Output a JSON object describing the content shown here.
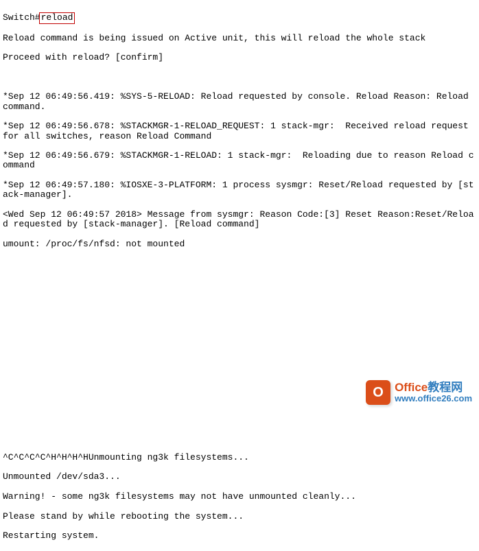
{
  "terminal": {
    "prompt": "Switch#",
    "command": "reload",
    "lines": [
      "Reload command is being issued on Active unit, this will reload the whole stack",
      "Proceed with reload? [confirm]",
      "",
      "*Sep 12 06:49:56.419: %SYS-5-RELOAD: Reload requested by console. Reload Reason: Reload command.",
      "*Sep 12 06:49:56.678: %STACKMGR-1-RELOAD_REQUEST: 1 stack-mgr:  Received reload request for all switches, reason Reload Command",
      "*Sep 12 06:49:56.679: %STACKMGR-1-RELOAD: 1 stack-mgr:  Reloading due to reason Reload command",
      "*Sep 12 06:49:57.180: %IOSXE-3-PLATFORM: 1 process sysmgr: Reset/Reload requested by [stack-manager].",
      "<Wed Sep 12 06:49:57 2018> Message from sysmgr: Reason Code:[3] Reset Reason:Reset/Reload requested by [stack-manager]. [Reload command]",
      "umount: /proc/fs/nfsd: not mounted"
    ],
    "bottom_lines": [
      "^C^C^C^C^H^H^H^HUnmounting ng3k filesystems...",
      "Unmounted /dev/sda3...",
      "Warning! - some ng3k filesystems may not have unmounted cleanly...",
      "Please stand by while rebooting the system...",
      "Restarting system."
    ]
  },
  "watermark": {
    "icon_letter": "O",
    "title_part1": "Office",
    "title_part2": "教程网",
    "url": "www.office26.com"
  }
}
